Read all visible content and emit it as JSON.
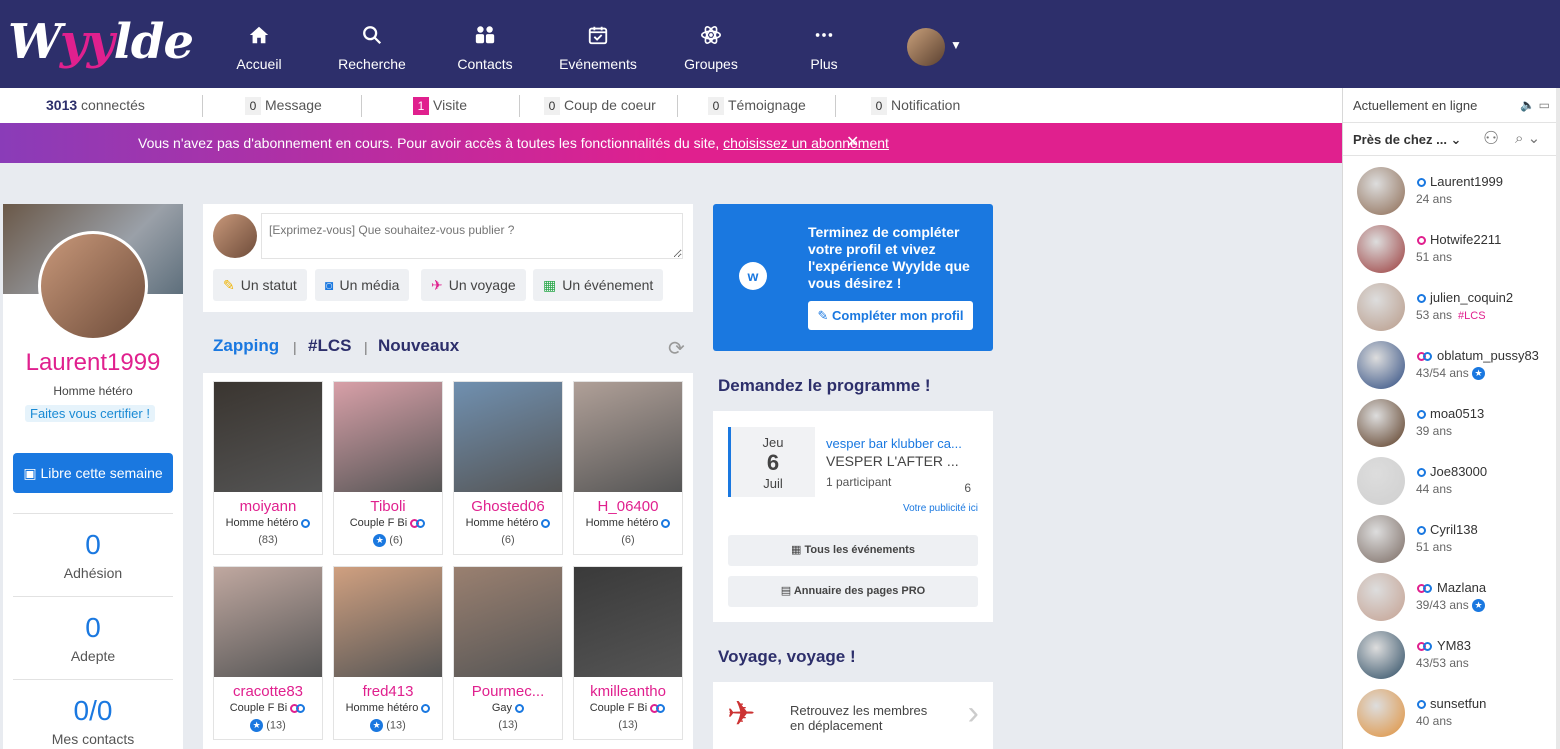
{
  "nav": {
    "logo_a": "W",
    "logo_b": "yy",
    "logo_c": "lde",
    "items": [
      {
        "label": "Accueil",
        "icon": "home-icon"
      },
      {
        "label": "Recherche",
        "icon": "search-icon"
      },
      {
        "label": "Contacts",
        "icon": "contacts-icon"
      },
      {
        "label": "Evénements",
        "icon": "calendar-icon"
      },
      {
        "label": "Groupes",
        "icon": "atom-icon"
      },
      {
        "label": "Plus",
        "icon": "more-icon"
      }
    ]
  },
  "stats": {
    "connected_count": "3013",
    "connected_label": "connectés",
    "message_count": "0",
    "message_label": "Message",
    "visit_count": "1",
    "visit_label": "Visite",
    "heart_count": "0",
    "heart_label": "Coup de coeur",
    "testimony_count": "0",
    "testimony_label": "Témoignage",
    "notif_count": "0",
    "notif_label": "Notification"
  },
  "banner": {
    "text": "Vous n'avez pas d'abonnement en cours. Pour avoir accès à toutes les fonctionnalités du site,",
    "link": "choisissez un abonnement",
    "close": "✕"
  },
  "profile": {
    "username": "Laurent1999",
    "orientation": "Homme hétéro",
    "certify": "Faites vous certifier !",
    "libre": "Libre cette semaine",
    "stats": [
      {
        "value": "0",
        "label": "Adhésion"
      },
      {
        "value": "0",
        "label": "Adepte"
      },
      {
        "value": "0/0",
        "label": "Mes contacts"
      }
    ]
  },
  "composer": {
    "placeholder": "[Exprimez-vous] Que souhaitez-vous publier ?",
    "actions": [
      "Un statut",
      "Un média",
      "Un voyage",
      "Un événement"
    ]
  },
  "tabs": {
    "zapping": "Zapping",
    "lcs": "#LCS",
    "nouveaux": "Nouveaux",
    "sep": "|"
  },
  "members": [
    {
      "name": "moiyann",
      "type": "Homme hétéro",
      "rating": "(83)",
      "star": false
    },
    {
      "name": "Tiboli",
      "type": "Couple F Bi",
      "rating": "(6)",
      "star": true
    },
    {
      "name": "Ghosted06",
      "type": "Homme hétéro",
      "rating": "(6)",
      "star": false
    },
    {
      "name": "H_06400",
      "type": "Homme hétéro",
      "rating": "(6)",
      "star": false
    },
    {
      "name": "cracotte83",
      "type": "Couple F Bi",
      "rating": "(13)",
      "star": true
    },
    {
      "name": "fred413",
      "type": "Homme hétéro",
      "rating": "(13)",
      "star": true
    },
    {
      "name": "Pourmec...",
      "type": "Gay",
      "rating": "(13)",
      "star": false
    },
    {
      "name": "kmilleantho",
      "type": "Couple F Bi",
      "rating": "(13)",
      "star": false
    }
  ],
  "promo": {
    "badge": "w",
    "text": "Terminez de compléter votre profil et vivez l'expérience Wyylde que vous désirez !",
    "button": "Compléter mon profil"
  },
  "programme": {
    "title": "Demandez le programme !",
    "event": {
      "day_name": "Jeu",
      "day": "6",
      "month": "Juil",
      "line1": "vesper bar klubber ca...",
      "line2": "VESPER L'AFTER ...",
      "participants": "1 participant",
      "count": "6"
    },
    "ad_link": "Votre publicité ici",
    "btn_events": "Tous les événements",
    "btn_pro": "Annuaire des pages PRO"
  },
  "travel": {
    "title": "Voyage, voyage !",
    "text_1": "Retrouvez les membres",
    "text_2": "en déplacement"
  },
  "online": {
    "header": "Actuellement en ligne",
    "filter": "Près de chez ...",
    "users": [
      {
        "name": "Laurent1999",
        "age": "24 ans",
        "kind": "dot",
        "color": "#8c6a52",
        "tag": "",
        "star": false
      },
      {
        "name": "Hotwife2211",
        "age": "51 ans",
        "kind": "dotpink",
        "color": "#9a3a3a",
        "tag": "",
        "star": false
      },
      {
        "name": "julien_coquin2",
        "age": "53 ans",
        "kind": "dot",
        "color": "#b89a88",
        "tag": "#LCS",
        "star": false
      },
      {
        "name": "oblatum_pussy83",
        "age": "43/54 ans",
        "kind": "ring",
        "color": "#2c4a80",
        "tag": "",
        "star": true
      },
      {
        "name": "moa0513",
        "age": "39 ans",
        "kind": "dot",
        "color": "#5a3a22",
        "tag": "",
        "star": false
      },
      {
        "name": "Joe83000",
        "age": "44 ans",
        "kind": "dot",
        "color": "#cfcfcf",
        "tag": "",
        "star": false
      },
      {
        "name": "Cyril138",
        "age": "51 ans",
        "kind": "dot",
        "color": "#7a6a62",
        "tag": "",
        "star": false
      },
      {
        "name": "Mazlana",
        "age": "39/43 ans",
        "kind": "ring",
        "color": "#c4a090",
        "tag": "",
        "star": true
      },
      {
        "name": "YM83",
        "age": "43/53 ans",
        "kind": "ring",
        "color": "#2a4a62",
        "tag": "",
        "star": false
      },
      {
        "name": "sunsetfun",
        "age": "40 ans",
        "kind": "dot",
        "color": "#e0903a",
        "tag": "",
        "star": false
      }
    ]
  }
}
